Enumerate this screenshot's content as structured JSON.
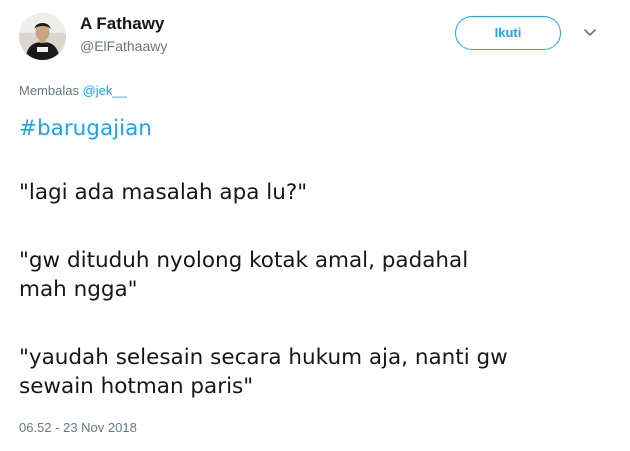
{
  "user": {
    "display_name": "A Fathawy",
    "handle": "@ElFathaawy"
  },
  "follow_button": {
    "label": "Ikuti"
  },
  "reply": {
    "prefix": "Membalas ",
    "mention": "@jek__"
  },
  "tweet": {
    "hashtag": "#barugajian",
    "lines": [
      "\"lagi ada masalah apa lu?\"",
      "\"gw dituduh nyolong kotak amal, padahal",
      "mah ngga\"",
      "\"yaudah selesain secara hukum aja, nanti gw",
      "sewain hotman paris\""
    ],
    "timestamp": "06.52 - 23 Nov 2018"
  },
  "colors": {
    "accent": "#1da1f2",
    "text": "#14171a",
    "muted": "#657786"
  },
  "icons": {
    "avatar": "profile-photo",
    "menu": "chevron-down-icon"
  }
}
